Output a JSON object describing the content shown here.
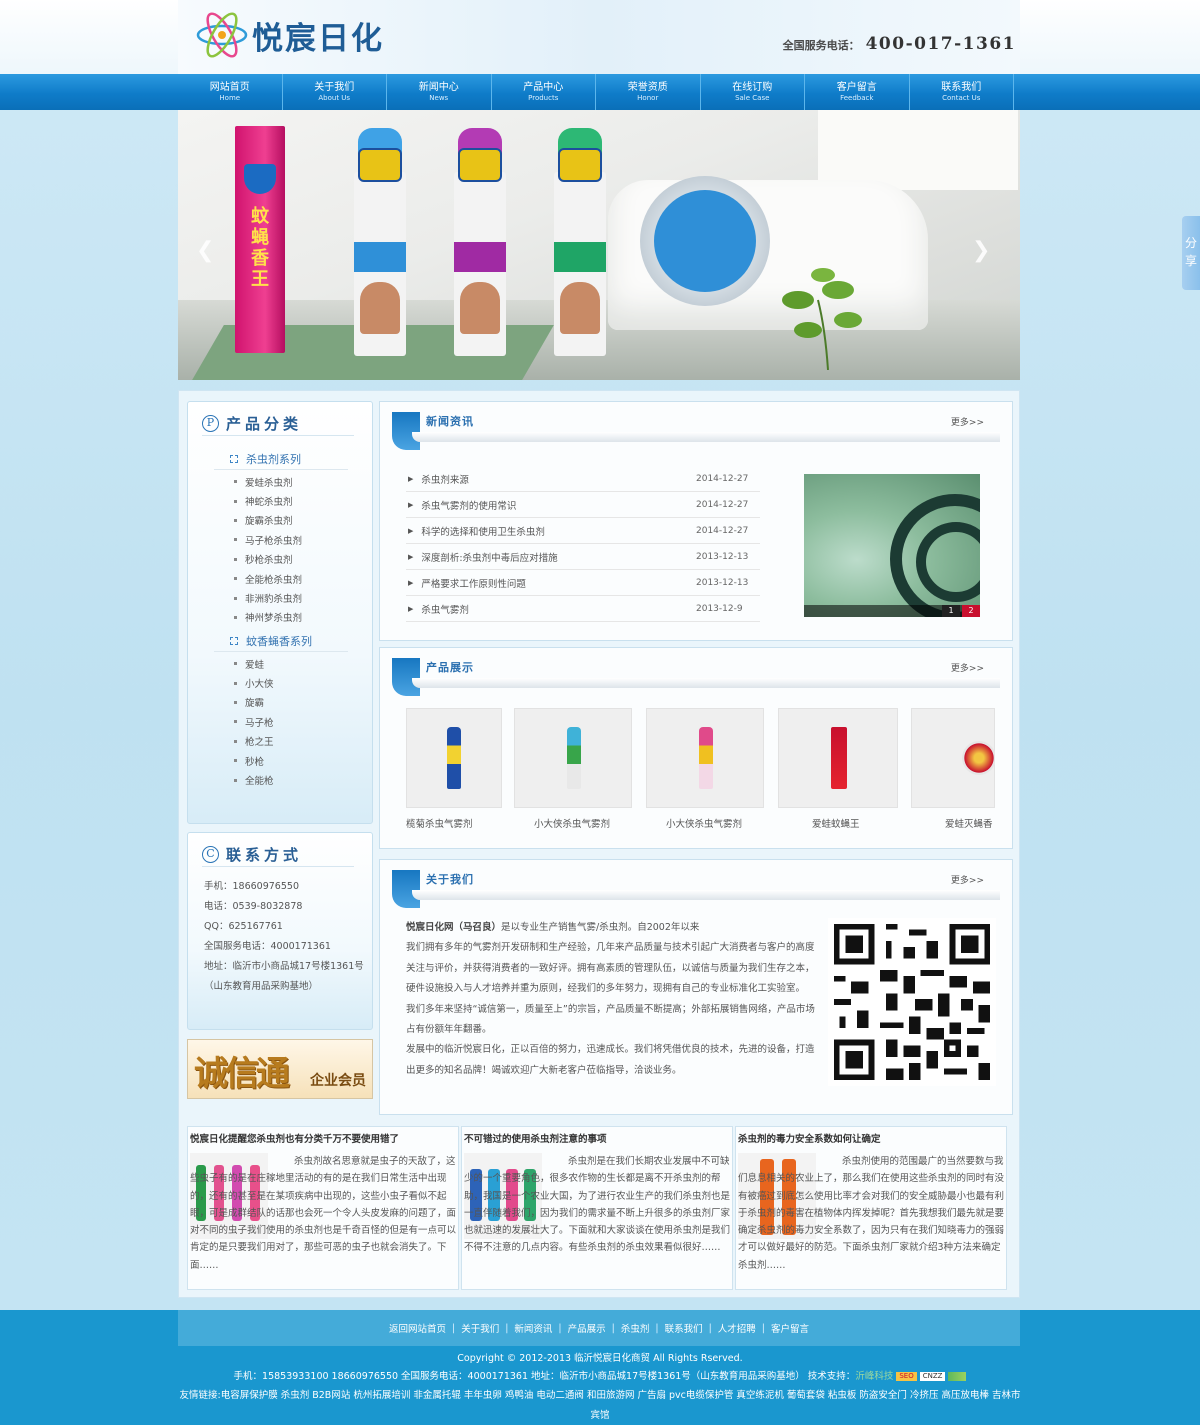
{
  "brand": {
    "name": "悦宸日化",
    "hotline_label": "全国服务电话：",
    "hotline": "400-017-1361"
  },
  "nav": [
    {
      "cn": "网站首页",
      "en": "Home"
    },
    {
      "cn": "关于我们",
      "en": "About Us"
    },
    {
      "cn": "新闻中心",
      "en": "News"
    },
    {
      "cn": "产品中心",
      "en": "Products"
    },
    {
      "cn": "荣誉资质",
      "en": "Honor"
    },
    {
      "cn": "在线订购",
      "en": "Sale Case"
    },
    {
      "cn": "客户留言",
      "en": "Feedback"
    },
    {
      "cn": "联系我们",
      "en": "Contact Us"
    }
  ],
  "banner": {
    "box_text": "蚊蝇香王"
  },
  "share": "分享",
  "sidebar": {
    "category_title": "产品分类",
    "category_icon": "P",
    "groups": [
      {
        "name": "杀虫剂系列",
        "items": [
          "爱蛙杀虫剂",
          "神蛇杀虫剂",
          "旋霸杀虫剂",
          "马子枪杀虫剂",
          "秒枪杀虫剂",
          "全能枪杀虫剂",
          "非洲豹杀虫剂",
          "神州梦杀虫剂"
        ]
      },
      {
        "name": "蚊香蝇香系列",
        "items": [
          "爱蛙",
          "小大侠",
          "旋霸",
          "马子枪",
          "枪之王",
          "秒枪",
          "全能枪"
        ]
      }
    ],
    "contact_title": "联系方式",
    "contact_icon": "C",
    "contact": {
      "mobile": "手机：18660976550",
      "phone": "电话：0539-8032878",
      "qq": "QQ：625167761",
      "hotline": "全国服务电话：4000171361",
      "address": "地址：临沂市小商品城17号楼1361号（山东教育用品采购基地）"
    },
    "chengxin": {
      "big": "诚信通",
      "small": "企业会员"
    }
  },
  "news": {
    "title": "新闻资讯",
    "more": "更多>>",
    "items": [
      {
        "title": "杀虫剂来源",
        "date": "2014-12-27"
      },
      {
        "title": "杀虫气雾剂的使用常识",
        "date": "2014-12-27"
      },
      {
        "title": "科学的选择和使用卫生杀虫剂",
        "date": "2014-12-27"
      },
      {
        "title": "深度剖析:杀虫剂中毒后应对措施",
        "date": "2013-12-13"
      },
      {
        "title": "严格要求工作原则性问题",
        "date": "2013-12-13"
      },
      {
        "title": "杀虫气雾剂",
        "date": "2013-12-9"
      }
    ],
    "pager": [
      "1",
      "2"
    ]
  },
  "products": {
    "title": "产品展示",
    "more": "更多>>",
    "items": [
      "榄菊杀虫气雾剂",
      "小大侠杀虫气雾剂",
      "小大侠杀虫气雾剂",
      "爱蛙蚊蝇王",
      "爱蛙灭蝇香"
    ]
  },
  "about": {
    "title": "关于我们",
    "more": "更多>>",
    "lead_bold": "悦宸日化网（马召良）",
    "lead_text": "是以专业生产销售气雾/杀虫剂。自2002年以来",
    "p1": "我们拥有多年的气雾剂开发研制和生产经验，几年来产品质量与技术引起广大消费者与客户的高度关注与评价，并获得消费者的一致好评。拥有高素质的管理队伍，以诚信与质量为我们生存之本，硬件设施投入与人才培养并重为原则，经我们的多年努力，现拥有自己的专业标准化工实验室。",
    "p2": "我们多年来坚持“诚信第一，质量至上”的宗旨，产品质量不断提高；外部拓展销售网络，产品市场占有份额年年翻番。",
    "p3": "发展中的临沂悦宸日化，正以百倍的努力，迅速成长。我们将凭借优良的技术，先进的设备，打造出更多的知名品牌！竭诚欢迎广大新老客户莅临指导，洽谈业务。"
  },
  "articles": [
    {
      "title": "悦宸日化提醒您杀虫剂也有分类千万不要使用错了",
      "text": "杀虫剂故名思意就是虫子的天敌了，这些虫子有的是在庄稼地里活动的有的是在我们日常生活中出现的，还有的甚至是在某项疾病中出现的，这些小虫子看似不起眼，可是成群结队的话那也会死一个令人头皮发麻的问题了，面对不同的虫子我们使用的杀虫剂也是千奇百怪的但是有一点可以肯定的是只要我们用对了，那些可恶的虫子也就会消失了。下面……"
    },
    {
      "title": "不可错过的使用杀虫剂注意的事项",
      "text": "杀虫剂是在我们长期农业发展中不可缺少的一个重要角色，很多农作物的生长都是离不开杀虫剂的帮助，我国是一个农业大国，为了进行农业生产的我们杀虫剂也是一直伴随着我们，因为我们的需求量不断上升很多的杀虫剂厂家也就迅速的发展壮大了。下面就和大家谈谈在使用杀虫剂是我们不得不注意的几点内容。有些杀虫剂的杀虫效果看似很好……"
    },
    {
      "title": "杀虫剂的毒力安全系数如何让确定",
      "text": "杀虫剂使用的范围最广的当然要数与我们息息相关的农业上了，那么我们在使用这些杀虫剂的同时有没有被癌过到底怎么使用比率才会对我们的安全威胁最小也最有利于杀虫剂的毒害在植物体内挥发掉呢？首先我想我们最先就是要确定杀虫剂的毒力安全系数了，因为只有在我们知晓毒力的强弱才可以做好最好的防范。下面杀虫剂厂家就介绍3种方法来确定杀虫剂……"
    }
  ],
  "footer": {
    "nav": [
      "返回网站首页",
      "关于我们",
      "新闻资讯",
      "产品展示",
      "杀虫剂",
      "联系我们",
      "人才招聘",
      "客户留言"
    ],
    "copyright": "Copyright © 2012-2013 临沂悦宸日化商贸 All Rights Rserved.",
    "info": "手机：15853933100 18660976550 全国服务电话：4000171361 地址：临沂市小商品城17号楼1361号（山东教育用品采购基地） 技术支持：",
    "support": "沂峰科技",
    "badges": [
      "SEO",
      "CNZZ"
    ],
    "links": "友情链接:电容屏保护膜 杀虫剂 B2B网站 杭州拓展培训 非金属托辊 丰年虫卵 鸡鸭油 电动二通阀 和田旅游网 广告扇 pvc电缆保护管 真空练泥机 葡萄套袋 粘虫板 防盗安全门 冷挤压 高压放电棒 吉林市宾馆"
  }
}
